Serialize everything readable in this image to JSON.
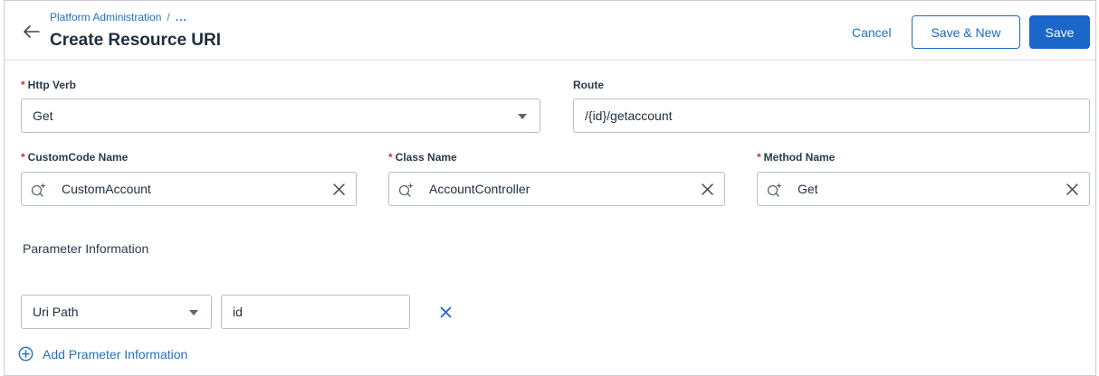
{
  "header": {
    "breadcrumb": "Platform Administration",
    "breadcrumb_separator": "/",
    "breadcrumb_more": "...",
    "title": "Create Resource URI",
    "cancel_label": "Cancel",
    "save_new_label": "Save & New",
    "save_label": "Save"
  },
  "form": {
    "http_verb": {
      "label": "Http Verb",
      "required_mark": "*",
      "value": "Get"
    },
    "route": {
      "label": "Route",
      "value": "/{id}/getaccount"
    },
    "customcode_name": {
      "label": "CustomCode Name",
      "required_mark": "*",
      "value": "CustomAccount"
    },
    "class_name": {
      "label": "Class Name",
      "required_mark": "*",
      "value": "AccountController"
    },
    "method_name": {
      "label": "Method Name",
      "required_mark": "*",
      "value": "Get"
    }
  },
  "parameters": {
    "section_title": "Parameter Information",
    "rows": [
      {
        "type": "Uri Path",
        "name": "id"
      }
    ],
    "add_label": "Add Prameter Information"
  },
  "colors": {
    "accent": "#1b66c9",
    "link": "#2170c5",
    "required": "#c23934",
    "border": "#b9bfc7"
  },
  "icons": [
    "back-arrow-icon",
    "lookup-search-icon",
    "clear-icon",
    "dropdown-caret-icon",
    "remove-x-icon",
    "add-circle-icon"
  ]
}
